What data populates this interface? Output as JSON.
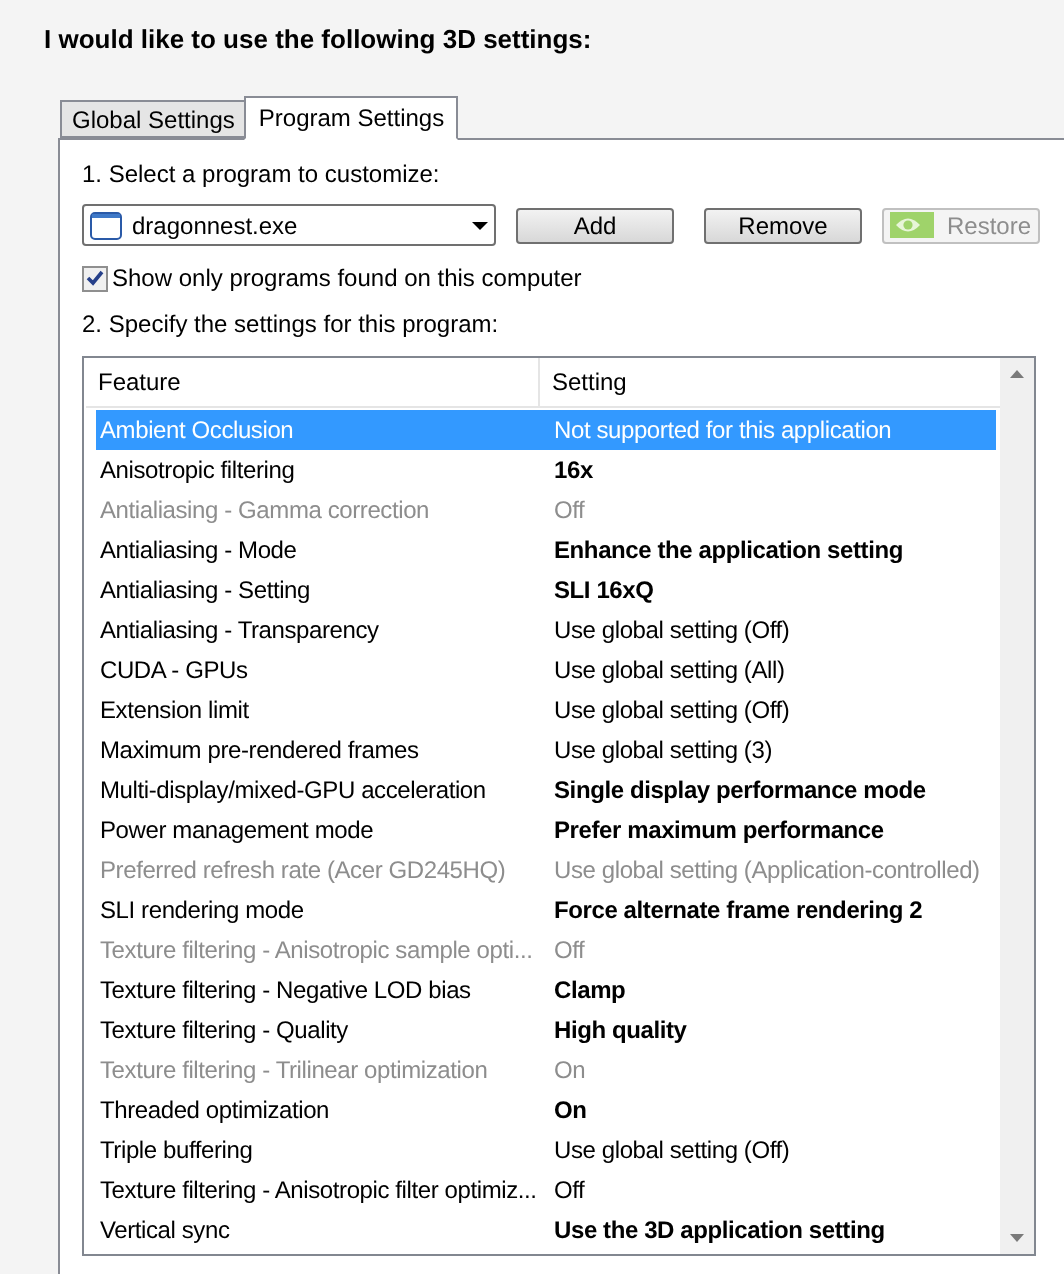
{
  "heading": "I would like to use the following 3D settings:",
  "tabs": [
    {
      "label": "Global Settings",
      "selected": false
    },
    {
      "label": "Program Settings",
      "selected": true
    }
  ],
  "select_label": "1. Select a program to customize:",
  "program": {
    "value": "dragonnest.exe"
  },
  "buttons": [
    {
      "label": "Add",
      "disabled": false,
      "kind": "plain"
    },
    {
      "label": "Remove",
      "disabled": false,
      "kind": "plain"
    },
    {
      "label": "Restore",
      "disabled": true,
      "kind": "logo"
    }
  ],
  "show_only_found": {
    "label": "Show only programs found on this computer",
    "checked": true
  },
  "specify_label": "2. Specify the settings for this program:",
  "table": {
    "columns": [
      "Feature",
      "Setting"
    ],
    "rows": [
      {
        "feature": "Ambient Occlusion",
        "setting": "Not supported for this application",
        "selected": true,
        "disabled": false,
        "modified": false
      },
      {
        "feature": "Anisotropic filtering",
        "setting": "16x",
        "selected": false,
        "disabled": false,
        "modified": true
      },
      {
        "feature": "Antialiasing - Gamma correction",
        "setting": "Off",
        "selected": false,
        "disabled": true,
        "modified": false
      },
      {
        "feature": "Antialiasing - Mode",
        "setting": "Enhance the application setting",
        "selected": false,
        "disabled": false,
        "modified": true
      },
      {
        "feature": "Antialiasing - Setting",
        "setting": "SLI 16xQ",
        "selected": false,
        "disabled": false,
        "modified": true
      },
      {
        "feature": "Antialiasing - Transparency",
        "setting": "Use global setting (Off)",
        "selected": false,
        "disabled": false,
        "modified": false
      },
      {
        "feature": "CUDA - GPUs",
        "setting": "Use global setting (All)",
        "selected": false,
        "disabled": false,
        "modified": false
      },
      {
        "feature": "Extension limit",
        "setting": "Use global setting (Off)",
        "selected": false,
        "disabled": false,
        "modified": false
      },
      {
        "feature": "Maximum pre-rendered frames",
        "setting": "Use global setting (3)",
        "selected": false,
        "disabled": false,
        "modified": false
      },
      {
        "feature": "Multi-display/mixed-GPU acceleration",
        "setting": "Single display performance mode",
        "selected": false,
        "disabled": false,
        "modified": true
      },
      {
        "feature": "Power management mode",
        "setting": "Prefer maximum performance",
        "selected": false,
        "disabled": false,
        "modified": true
      },
      {
        "feature": "Preferred refresh rate (Acer GD245HQ)",
        "setting": "Use global setting (Application-controlled)",
        "selected": false,
        "disabled": true,
        "modified": false
      },
      {
        "feature": "SLI rendering mode",
        "setting": "Force alternate frame rendering 2",
        "selected": false,
        "disabled": false,
        "modified": true
      },
      {
        "feature": "Texture filtering - Anisotropic sample opti...",
        "setting": "Off",
        "selected": false,
        "disabled": true,
        "modified": false
      },
      {
        "feature": "Texture filtering - Negative LOD bias",
        "setting": "Clamp",
        "selected": false,
        "disabled": false,
        "modified": true
      },
      {
        "feature": "Texture filtering - Quality",
        "setting": "High quality",
        "selected": false,
        "disabled": false,
        "modified": true
      },
      {
        "feature": "Texture filtering - Trilinear optimization",
        "setting": "On",
        "selected": false,
        "disabled": true,
        "modified": false
      },
      {
        "feature": "Threaded optimization",
        "setting": "On",
        "selected": false,
        "disabled": false,
        "modified": true
      },
      {
        "feature": "Triple buffering",
        "setting": "Use global setting (Off)",
        "selected": false,
        "disabled": false,
        "modified": false
      },
      {
        "feature": "Texture filtering - Anisotropic filter optimiz...",
        "setting": "Off",
        "selected": false,
        "disabled": false,
        "modified": false
      },
      {
        "feature": "Vertical sync",
        "setting": "Use the 3D application setting",
        "selected": false,
        "disabled": false,
        "modified": true
      }
    ]
  }
}
